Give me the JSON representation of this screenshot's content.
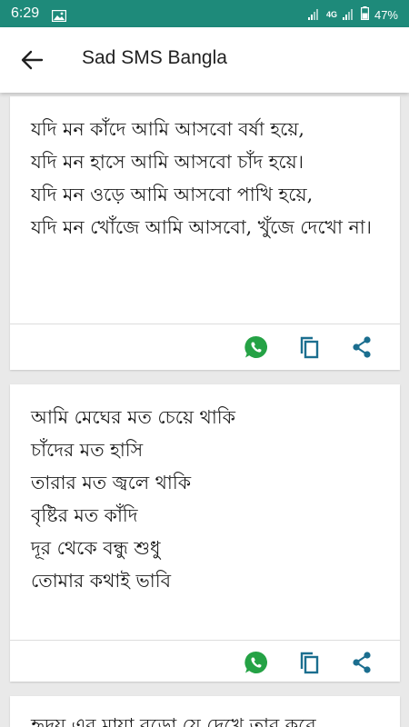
{
  "status_bar": {
    "time": "6:29",
    "network": "4G",
    "battery": "47%",
    "icons": [
      "gallery-icon",
      "signal-icon",
      "4g-signal-icon",
      "battery-icon"
    ]
  },
  "app_bar": {
    "title": "Sad SMS Bangla",
    "back_icon": "arrow-back-icon"
  },
  "colors": {
    "status_bar": "#1e8a7a",
    "whatsapp": "#25a245",
    "accent": "#1b6e8f",
    "background": "#e9e9e9"
  },
  "cards": [
    {
      "text": "যদি মন কাঁদে আমি আসবো বর্ষা হয়ে,\nযদি মন হাসে আমি আসবো চাঁদ হয়ে।\nযদি মন ওড়ে আমি আসবো পাখি হয়ে,\nযদি মন খোঁজে আমি আসবো, খুঁজে দেখো না।",
      "actions": [
        "whatsapp-share",
        "copy",
        "share"
      ]
    },
    {
      "text": "আমি মেঘের মত চেয়ে থাকি\nচাঁদের মত হাসি\nতারার মত জ্বলে থাকি\nবৃষ্টির মত কাঁদি\nদূর থেকে বন্ধু শুধু\nতোমার কথাই ভাবি",
      "actions": [
        "whatsapp-share",
        "copy",
        "share"
      ]
    },
    {
      "text": "হৃদয় এর মায়া বড়ো যে দেখে তার করে",
      "actions": []
    }
  ]
}
